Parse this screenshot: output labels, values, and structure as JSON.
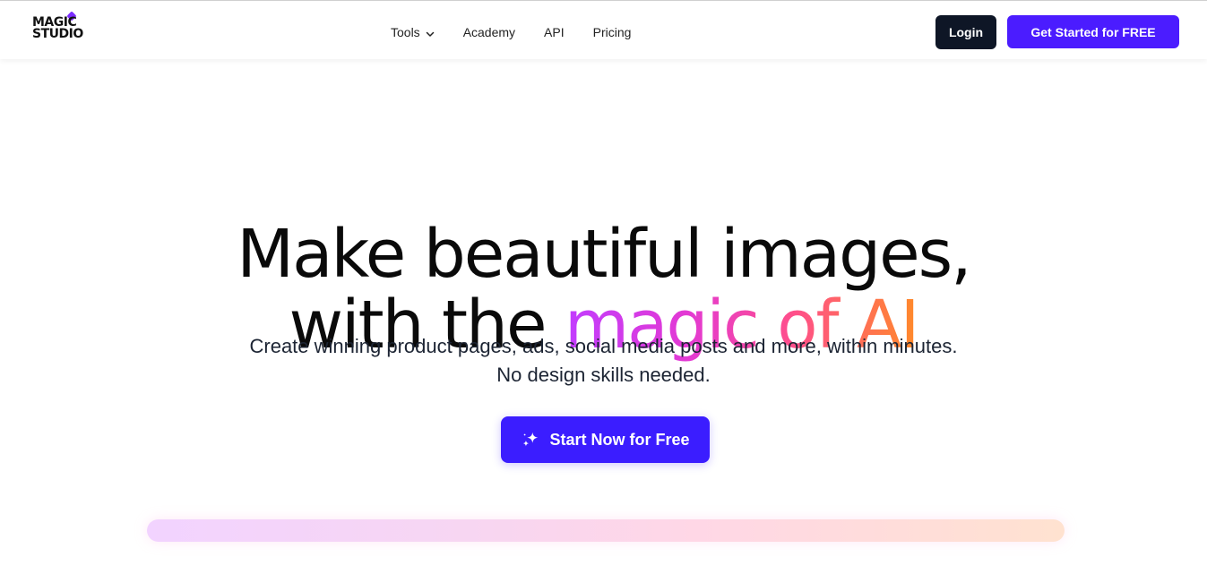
{
  "brand": {
    "logo_line1": "MAGIC",
    "logo_line2": "STUDIO"
  },
  "nav": {
    "items": [
      {
        "label": "Tools"
      },
      {
        "label": "Academy"
      },
      {
        "label": "API"
      },
      {
        "label": "Pricing"
      }
    ]
  },
  "header_actions": {
    "login_label": "Login",
    "get_started_label": "Get Started for FREE"
  },
  "hero": {
    "title_line1": "Make beautiful images,",
    "title_line2_prefix": "with the",
    "title_line2_highlight": "magic of AI",
    "subtitle_line1": "Create winning product pages, ads, social media posts and more, within minutes.",
    "subtitle_line2": "No design skills needed.",
    "cta_label": "Start Now for Free"
  },
  "colors": {
    "accent": "#4b1cff",
    "cta": "#3b1dff",
    "login_bg": "#0e1626",
    "gradient_start": "#c13cff",
    "gradient_end": "#ff8a2a"
  },
  "icons": {
    "nav_tools_dropdown": "chevron-down-icon",
    "cta_icon": "sparkles-icon"
  }
}
